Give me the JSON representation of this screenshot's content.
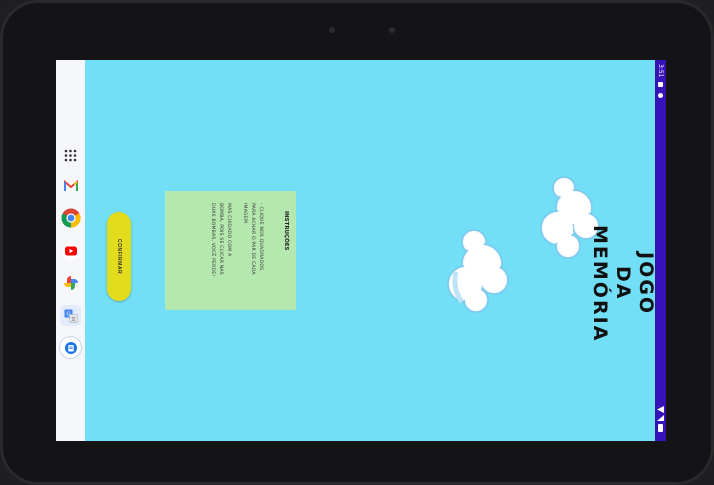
{
  "app": {
    "title": "JOGO DA MEMÓRIA",
    "title_lines": [
      "JOGO",
      "DA",
      "MEMÓRIA"
    ]
  },
  "instructions": {
    "heading": "INSTRUÇÕES",
    "lines": [
      "- CLIQUE NOS QUADRADOS",
      "PARA ACHAR O PAR DE CADA",
      "IMAGEM",
      "",
      "MAS CUIDADO COM A",
      "BOMBA, POIS SE CLICAR NAS",
      "DUAS BOMBAS, VOCÊ PERDE!"
    ]
  },
  "confirm_button": {
    "label": "CONFIRMAR"
  },
  "status_bar": {
    "time": "3:51"
  },
  "taskbar": {
    "icons": [
      "app-drawer-icon",
      "gmail-icon",
      "chrome-icon",
      "youtube-icon",
      "photos-icon",
      "translate-icon",
      "files-icon"
    ]
  },
  "colors": {
    "background": "#72dff6",
    "card": "#b5e8ae",
    "button": "#e3dc1c",
    "status_bar": "#3513b7"
  }
}
